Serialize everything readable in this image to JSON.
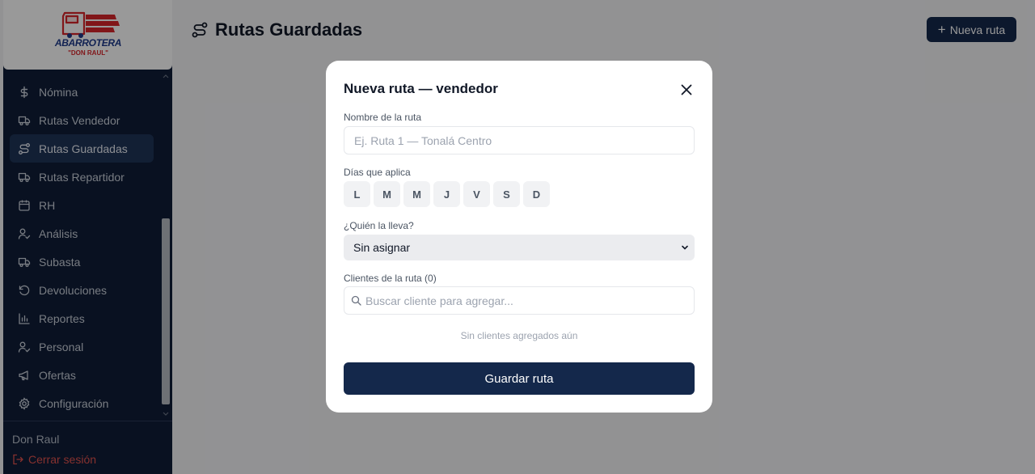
{
  "sidebar": {
    "logo": {
      "line1": "ABARROTERA",
      "line2": "\"DON RAUL\""
    },
    "items": [
      {
        "label": "Nómina",
        "icon": "dollar-icon",
        "active": false
      },
      {
        "label": "Rutas Vendedor",
        "icon": "truck-icon",
        "active": false
      },
      {
        "label": "Rutas Guardadas",
        "icon": "route-icon",
        "active": true
      },
      {
        "label": "Rutas Repartidor",
        "icon": "truck-icon",
        "active": false
      },
      {
        "label": "RH",
        "icon": "calendar-icon",
        "active": false
      },
      {
        "label": "Análisis",
        "icon": "user-check-icon",
        "active": false
      },
      {
        "label": "Subasta",
        "icon": "truck-icon",
        "active": false
      },
      {
        "label": "Devoluciones",
        "icon": "rotate-ccw-icon",
        "active": false
      },
      {
        "label": "Reportes",
        "icon": "bar-chart-icon",
        "active": false
      },
      {
        "label": "Personal",
        "icon": "user-check-icon",
        "active": false
      },
      {
        "label": "Ofertas",
        "icon": "megaphone-icon",
        "active": false
      },
      {
        "label": "Configuración",
        "icon": "gear-icon",
        "active": false
      }
    ],
    "user_name": "Don Raul",
    "logout_label": "Cerrar sesión"
  },
  "header": {
    "title": "Rutas Guardadas",
    "new_route_label": "Nueva ruta"
  },
  "modal": {
    "title": "Nueva ruta — vendedor",
    "route_name_label": "Nombre de la ruta",
    "route_name_placeholder": "Ej. Ruta 1 — Tonalá Centro",
    "route_name_value": "",
    "days_label": "Días que aplica",
    "days": [
      "L",
      "M",
      "M",
      "J",
      "V",
      "S",
      "D"
    ],
    "assignee_label": "¿Quién la lleva?",
    "assignee_selected": "Sin asignar",
    "clients_label": "Clientes de la ruta (0)",
    "client_search_placeholder": "Buscar cliente para agregar...",
    "empty_clients_message": "Sin clientes agregados aún",
    "save_label": "Guardar ruta"
  },
  "colors": {
    "sidebar_bg": "#0f1d38",
    "primary": "#14284b",
    "logout": "#e0524d",
    "logo_red": "#d7262b",
    "logo_blue": "#1d3a8a"
  }
}
